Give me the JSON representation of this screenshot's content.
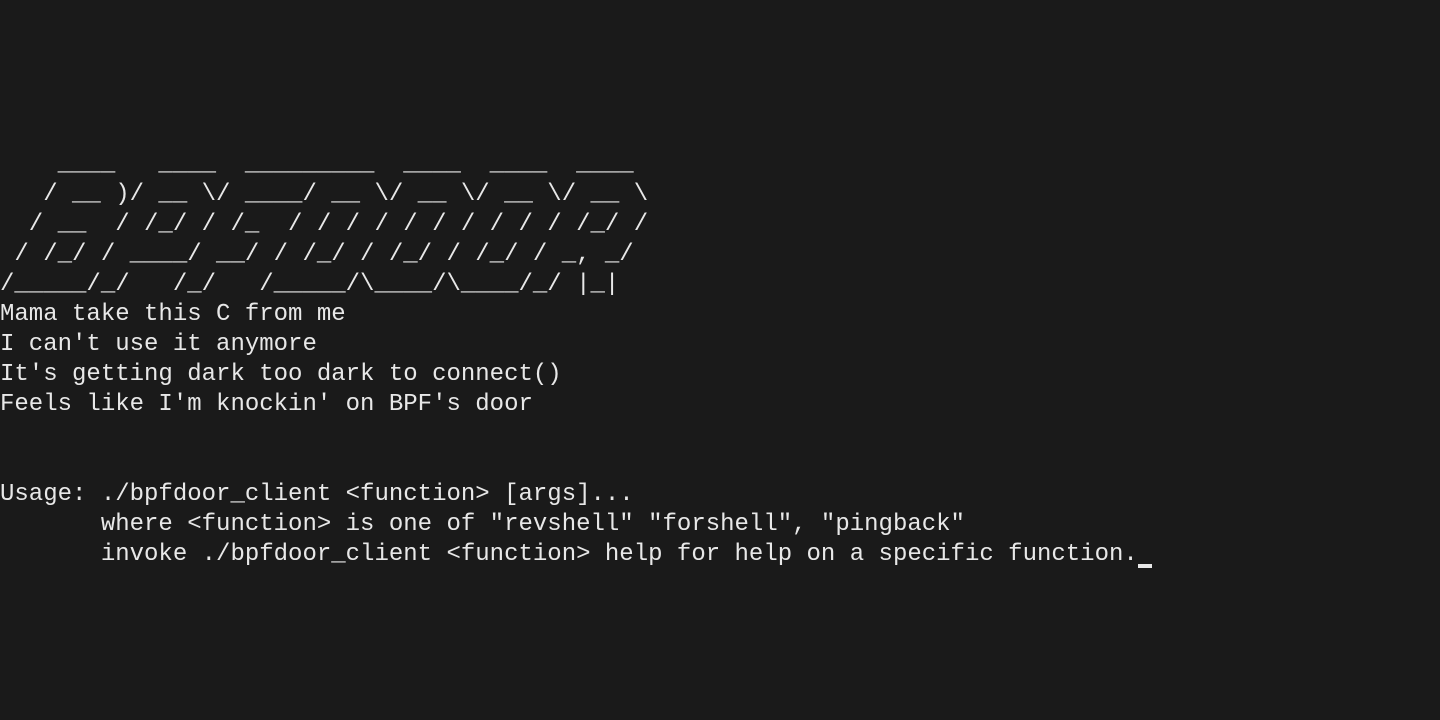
{
  "terminal": {
    "ascii_art": "    ____   ____  _________  ____  ____  ____\n   / __ )/ __ \\/ ____/ __ \\/ __ \\/ __ \\/ __ \\\n  / __  / /_/ / /_  / / / / / / / / / / /_/ /\n / /_/ / ____/ __/ / /_/ / /_/ / /_/ / _, _/\n/_____/_/   /_/   /_____/\\____/\\____/_/ |_|",
    "lyric1": "Mama take this C from me",
    "lyric2": "I can't use it anymore",
    "lyric3": "It's getting dark too dark to connect()",
    "lyric4": "Feels like I'm knockin' on BPF's door",
    "blank1": "",
    "blank2": "",
    "usage_line1": "Usage: ./bpfdoor_client <function> [args]...",
    "usage_line2": "       where <function> is one of \"revshell\" \"forshell\", \"pingback\"",
    "usage_line3": "       invoke ./bpfdoor_client <function> help for help on a specific function."
  }
}
